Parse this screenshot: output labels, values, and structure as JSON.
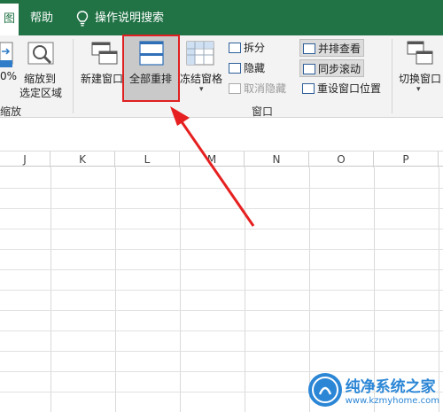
{
  "tabs": {
    "view": "图",
    "help": "帮助",
    "search": "操作说明搜索"
  },
  "zoom": {
    "percent_label": "0%",
    "selection_label_1": "缩放到",
    "selection_label_2": "选定区域",
    "group": "缩放"
  },
  "window": {
    "new_window": "新建窗口",
    "arrange_all": "全部重排",
    "freeze_panes": "冻结窗格",
    "split": "拆分",
    "hide": "隐藏",
    "unhide": "取消隐藏",
    "view_side_by_side": "并排查看",
    "sync_scroll": "同步滚动",
    "reset_position": "重设窗口位置",
    "switch_windows": "切换窗口",
    "group": "窗口"
  },
  "columns": [
    "J",
    "K",
    "L",
    "M",
    "N",
    "O",
    "P"
  ],
  "watermark": {
    "main": "纯净系统之家",
    "sub": "www.kzmyhome.com"
  },
  "colors": {
    "ribbon_green": "#217346",
    "highlight_red": "#e02020",
    "arrow_red": "#e62020"
  }
}
